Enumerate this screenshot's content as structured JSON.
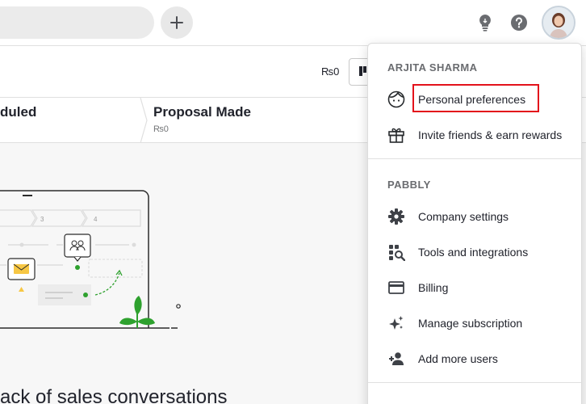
{
  "header": {
    "search_placeholder": "",
    "add_icon": "plus-icon",
    "tips_icon": "lightbulb-icon",
    "help_icon": "question-icon"
  },
  "toolbar": {
    "amount": "₨0"
  },
  "stages": [
    {
      "title": "duled",
      "amount": ""
    },
    {
      "title": "Proposal Made",
      "amount": "₨0"
    }
  ],
  "illustration": {
    "steps": [
      "3",
      "4"
    ]
  },
  "empty_state": {
    "heading": "rack of sales conversations"
  },
  "user_menu": {
    "user_section": "ARJITA SHARMA",
    "user_items": [
      {
        "label": "Personal preferences",
        "icon": "face-icon"
      },
      {
        "label": "Invite friends & earn rewards",
        "icon": "gift-icon"
      }
    ],
    "company_section": "PABBLY",
    "company_items": [
      {
        "label": "Company settings",
        "icon": "gear-icon"
      },
      {
        "label": "Tools and integrations",
        "icon": "tools-icon"
      },
      {
        "label": "Billing",
        "icon": "credit-card-icon"
      },
      {
        "label": "Manage subscription",
        "icon": "sparkle-icon"
      },
      {
        "label": "Add more users",
        "icon": "add-user-icon"
      }
    ]
  },
  "colors": {
    "highlight": "#e3121b",
    "leaf": "#2ea12e",
    "mail": "#f7c744"
  }
}
